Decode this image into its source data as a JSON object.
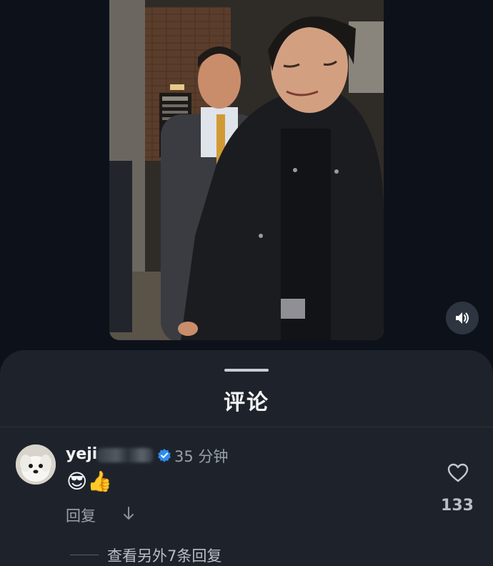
{
  "video": {
    "mute_icon": "speaker-icon"
  },
  "comments_sheet": {
    "title": "评论"
  },
  "comment": {
    "avatar_icon": "dog-avatar",
    "username": "yeji",
    "verified_icon": "verified-badge-icon",
    "timestamp": "35 分钟",
    "text": "😎👍",
    "reply_label": "回复",
    "like_icon": "heart-icon",
    "like_count": "133",
    "more_replies_label": "查看另外7条回复"
  },
  "colors": {
    "background": "#0d121a",
    "sheet": "#1e232b",
    "verified": "#2e8cf0",
    "secondary_text": "#9aa1ab"
  }
}
